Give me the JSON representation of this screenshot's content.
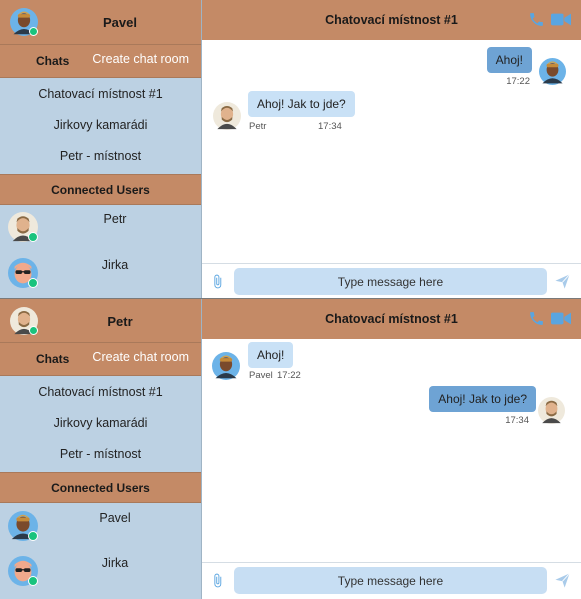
{
  "panels": [
    {
      "current_user": {
        "name": "Pavel",
        "avatar": "dark-man-avatar-icon"
      },
      "chats_label": "Chats",
      "create_label": "Create chat room",
      "rooms": [
        "Chatovací místnost #1",
        "Jirkovy kamarádi",
        "Petr - místnost"
      ],
      "connected_label": "Connected Users",
      "connected_users": [
        {
          "name": "Petr",
          "avatar": "light-man-avatar-icon"
        },
        {
          "name": "Jirka",
          "avatar": "sunglasses-avatar-icon"
        }
      ],
      "chat_title": "Chatovací místnost #1",
      "messages": [
        {
          "text": "Ahoj!",
          "time": "17:22",
          "sender": "",
          "direction": "out"
        },
        {
          "text": "Ahoj! Jak to jde?",
          "time": "17:34",
          "sender": "Petr",
          "direction": "in"
        }
      ],
      "input_placeholder": "Type message here"
    },
    {
      "current_user": {
        "name": "Petr",
        "avatar": "light-man-avatar-icon"
      },
      "chats_label": "Chats",
      "create_label": "Create chat room",
      "rooms": [
        "Chatovací místnost #1",
        "Jirkovy kamarádi",
        "Petr - místnost"
      ],
      "connected_label": "Connected Users",
      "connected_users": [
        {
          "name": "Pavel",
          "avatar": "dark-man-avatar-icon"
        },
        {
          "name": "Jirka",
          "avatar": "sunglasses-avatar-icon"
        }
      ],
      "chat_title": "Chatovací místnost #1",
      "messages": [
        {
          "text": "Ahoj!",
          "time": "17:22",
          "sender": "Pavel",
          "direction": "in"
        },
        {
          "text": "Ahoj! Jak to jde?",
          "time": "17:34",
          "sender": "",
          "direction": "out"
        }
      ],
      "input_placeholder": "Type message here"
    }
  ],
  "colors": {
    "header_brown": "#c48a66",
    "sidebar_blue": "#bcd1e3",
    "bubble_out": "#6ea3d4",
    "bubble_in": "#c9e1f6",
    "icon_blue": "#5aa5e0",
    "online_green": "#19c37d"
  }
}
